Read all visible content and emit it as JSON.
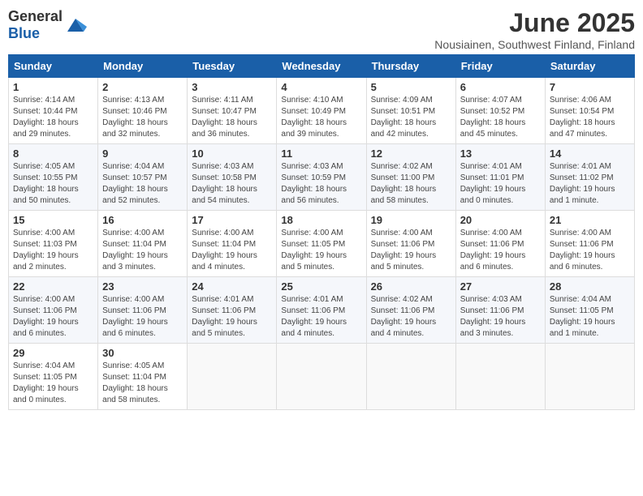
{
  "logo": {
    "general": "General",
    "blue": "Blue"
  },
  "title": "June 2025",
  "location": "Nousiainen, Southwest Finland, Finland",
  "days_of_week": [
    "Sunday",
    "Monday",
    "Tuesday",
    "Wednesday",
    "Thursday",
    "Friday",
    "Saturday"
  ],
  "weeks": [
    [
      {
        "day": "1",
        "sunrise": "4:14 AM",
        "sunset": "10:44 PM",
        "daylight": "18 hours and 29 minutes."
      },
      {
        "day": "2",
        "sunrise": "4:13 AM",
        "sunset": "10:46 PM",
        "daylight": "18 hours and 32 minutes."
      },
      {
        "day": "3",
        "sunrise": "4:11 AM",
        "sunset": "10:47 PM",
        "daylight": "18 hours and 36 minutes."
      },
      {
        "day": "4",
        "sunrise": "4:10 AM",
        "sunset": "10:49 PM",
        "daylight": "18 hours and 39 minutes."
      },
      {
        "day": "5",
        "sunrise": "4:09 AM",
        "sunset": "10:51 PM",
        "daylight": "18 hours and 42 minutes."
      },
      {
        "day": "6",
        "sunrise": "4:07 AM",
        "sunset": "10:52 PM",
        "daylight": "18 hours and 45 minutes."
      },
      {
        "day": "7",
        "sunrise": "4:06 AM",
        "sunset": "10:54 PM",
        "daylight": "18 hours and 47 minutes."
      }
    ],
    [
      {
        "day": "8",
        "sunrise": "4:05 AM",
        "sunset": "10:55 PM",
        "daylight": "18 hours and 50 minutes."
      },
      {
        "day": "9",
        "sunrise": "4:04 AM",
        "sunset": "10:57 PM",
        "daylight": "18 hours and 52 minutes."
      },
      {
        "day": "10",
        "sunrise": "4:03 AM",
        "sunset": "10:58 PM",
        "daylight": "18 hours and 54 minutes."
      },
      {
        "day": "11",
        "sunrise": "4:03 AM",
        "sunset": "10:59 PM",
        "daylight": "18 hours and 56 minutes."
      },
      {
        "day": "12",
        "sunrise": "4:02 AM",
        "sunset": "11:00 PM",
        "daylight": "18 hours and 58 minutes."
      },
      {
        "day": "13",
        "sunrise": "4:01 AM",
        "sunset": "11:01 PM",
        "daylight": "19 hours and 0 minutes."
      },
      {
        "day": "14",
        "sunrise": "4:01 AM",
        "sunset": "11:02 PM",
        "daylight": "19 hours and 1 minute."
      }
    ],
    [
      {
        "day": "15",
        "sunrise": "4:00 AM",
        "sunset": "11:03 PM",
        "daylight": "19 hours and 2 minutes."
      },
      {
        "day": "16",
        "sunrise": "4:00 AM",
        "sunset": "11:04 PM",
        "daylight": "19 hours and 3 minutes."
      },
      {
        "day": "17",
        "sunrise": "4:00 AM",
        "sunset": "11:04 PM",
        "daylight": "19 hours and 4 minutes."
      },
      {
        "day": "18",
        "sunrise": "4:00 AM",
        "sunset": "11:05 PM",
        "daylight": "19 hours and 5 minutes."
      },
      {
        "day": "19",
        "sunrise": "4:00 AM",
        "sunset": "11:06 PM",
        "daylight": "19 hours and 5 minutes."
      },
      {
        "day": "20",
        "sunrise": "4:00 AM",
        "sunset": "11:06 PM",
        "daylight": "19 hours and 6 minutes."
      },
      {
        "day": "21",
        "sunrise": "4:00 AM",
        "sunset": "11:06 PM",
        "daylight": "19 hours and 6 minutes."
      }
    ],
    [
      {
        "day": "22",
        "sunrise": "4:00 AM",
        "sunset": "11:06 PM",
        "daylight": "19 hours and 6 minutes."
      },
      {
        "day": "23",
        "sunrise": "4:00 AM",
        "sunset": "11:06 PM",
        "daylight": "19 hours and 6 minutes."
      },
      {
        "day": "24",
        "sunrise": "4:01 AM",
        "sunset": "11:06 PM",
        "daylight": "19 hours and 5 minutes."
      },
      {
        "day": "25",
        "sunrise": "4:01 AM",
        "sunset": "11:06 PM",
        "daylight": "19 hours and 4 minutes."
      },
      {
        "day": "26",
        "sunrise": "4:02 AM",
        "sunset": "11:06 PM",
        "daylight": "19 hours and 4 minutes."
      },
      {
        "day": "27",
        "sunrise": "4:03 AM",
        "sunset": "11:06 PM",
        "daylight": "19 hours and 3 minutes."
      },
      {
        "day": "28",
        "sunrise": "4:04 AM",
        "sunset": "11:05 PM",
        "daylight": "19 hours and 1 minute."
      }
    ],
    [
      {
        "day": "29",
        "sunrise": "4:04 AM",
        "sunset": "11:05 PM",
        "daylight": "19 hours and 0 minutes."
      },
      {
        "day": "30",
        "sunrise": "4:05 AM",
        "sunset": "11:04 PM",
        "daylight": "18 hours and 58 minutes."
      },
      null,
      null,
      null,
      null,
      null
    ]
  ]
}
